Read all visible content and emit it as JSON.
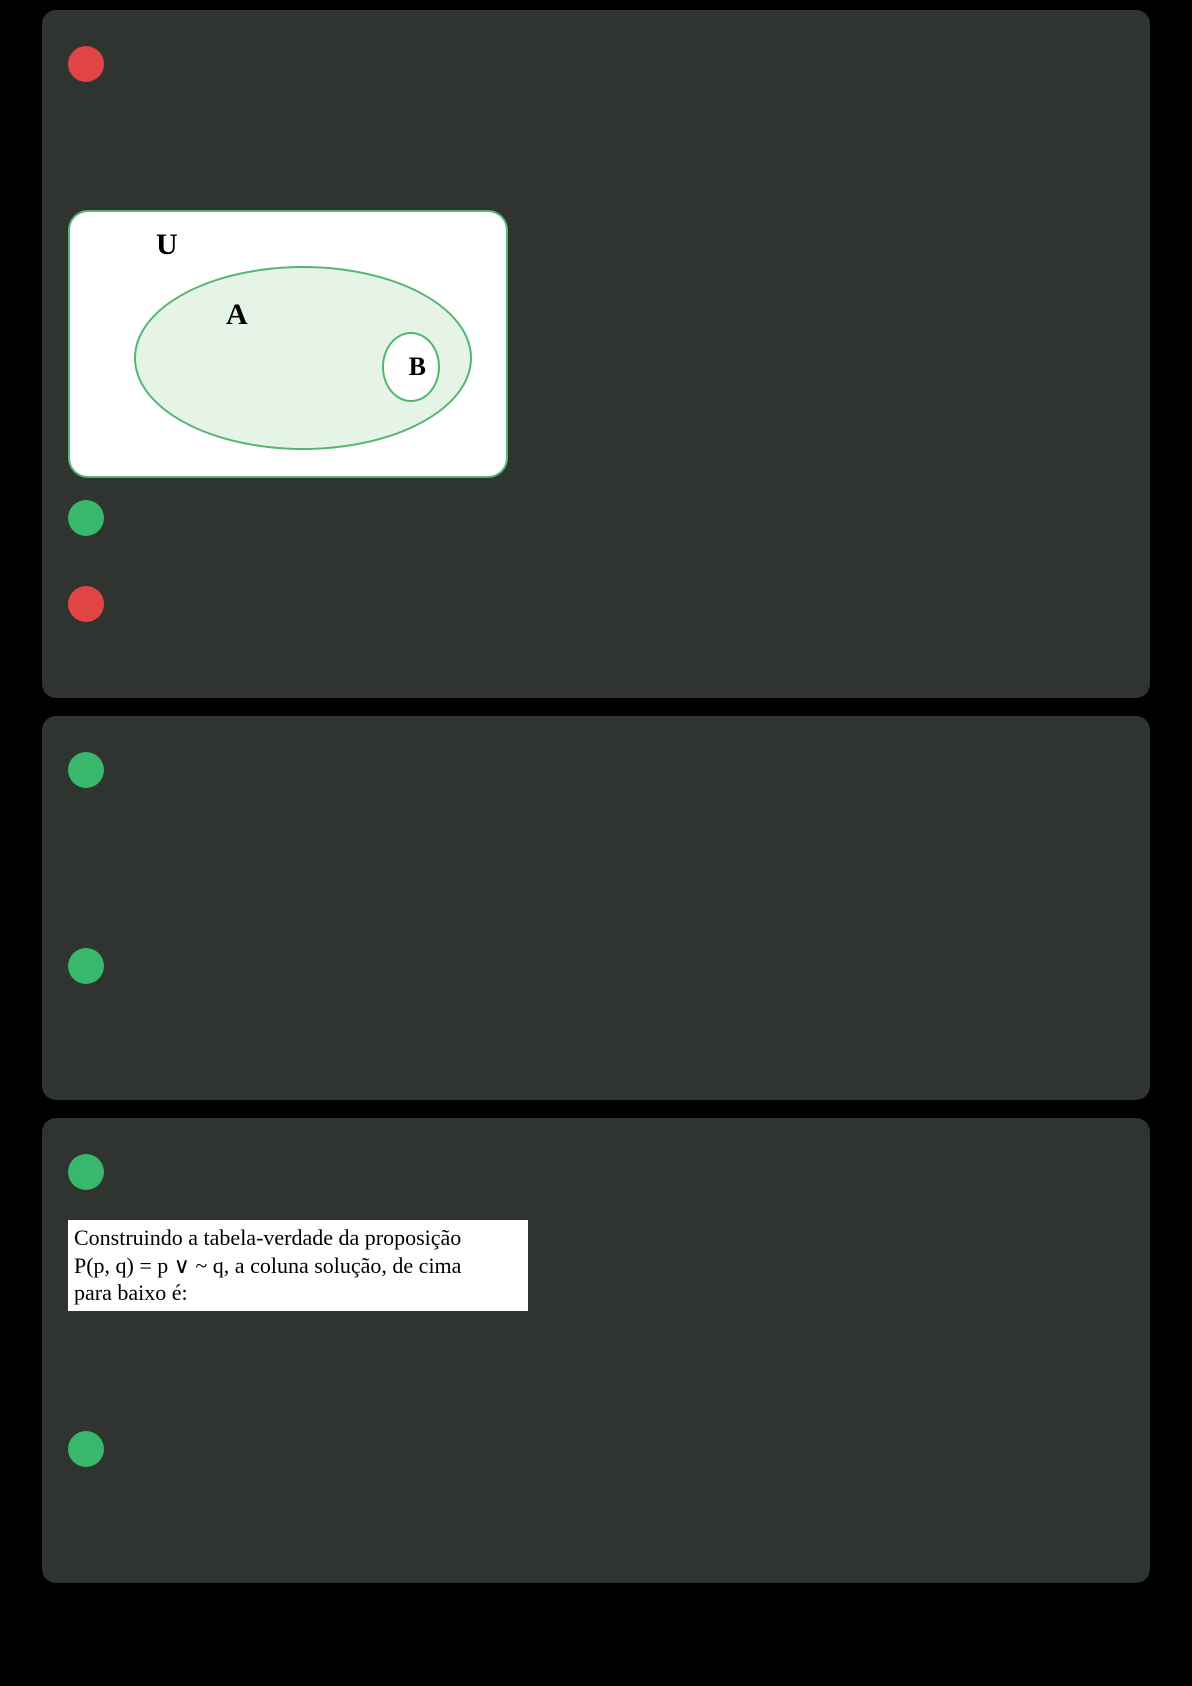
{
  "venn": {
    "universe_label": "U",
    "set_a_label": "A",
    "set_b_label": "B"
  },
  "truth_table_prompt": {
    "line1": "Construindo a tabela-verdade da proposição",
    "line2": "P(p, q) = p ∨ ~ q, a coluna solução, de cima",
    "line3": "para baixo é:"
  },
  "dots": {
    "q1_wrong": "",
    "q1_right": "",
    "q2_wrong": "",
    "q2_right": "",
    "q3_right": "",
    "q4_right": "",
    "q5_right": ""
  }
}
